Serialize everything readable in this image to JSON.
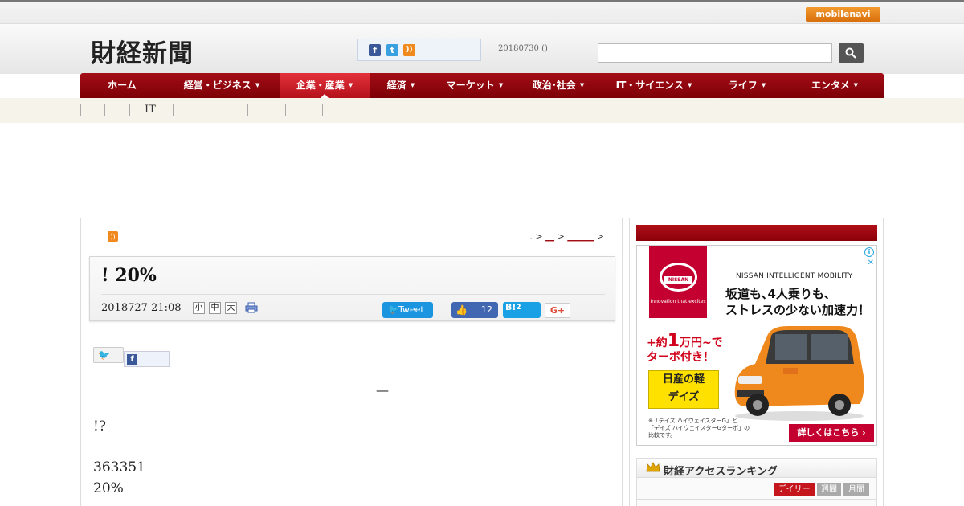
{
  "topbar": {
    "mobilenavi": "mobilenavi"
  },
  "header": {
    "logo": "財経新聞",
    "date": "20180730 ()",
    "search": {
      "value": "",
      "placeholder": ""
    },
    "social": {
      "facebook": "f",
      "twitter": "t",
      "rss": "))"
    }
  },
  "nav": {
    "items": [
      {
        "label": "ホーム",
        "caret": ""
      },
      {
        "label": "経営・ビジネス",
        "caret": "▼"
      },
      {
        "label": "企業・産業",
        "caret": "▼"
      },
      {
        "label": "経済",
        "caret": "▼"
      },
      {
        "label": "マーケット",
        "caret": "▼"
      },
      {
        "label": "政治･社会",
        "caret": "▼"
      },
      {
        "label": "IT・サイエンス",
        "caret": "▼"
      },
      {
        "label": "ライフ",
        "caret": "▼"
      },
      {
        "label": "エンタメ",
        "caret": "▼"
      }
    ],
    "active_index": 2
  },
  "subnav": {
    "items": [
      "",
      "",
      "IT",
      "",
      "",
      "",
      ""
    ]
  },
  "article": {
    "rss": "))",
    "breadcrumb": {
      "prefix": ". >",
      "link1": "__",
      "sep": ">",
      "link2": "______",
      "suffix": ">"
    },
    "title": "! 20%",
    "date": "2018727 21:08",
    "font_sizes": [
      "小",
      "中",
      "大"
    ],
    "tweet_label": "Tweet",
    "tweet_icon": "🐦",
    "like_icon": "👍",
    "like_count": "12",
    "hatena_label": "B!",
    "hatena_count": "2",
    "gplus_label": "G+",
    "share_tw_icon": "🐦",
    "share_fb_icon": "f",
    "dash": "—",
    "paragraphs": [
      "!?",
      "363351",
      "20%"
    ]
  },
  "sidebar": {
    "ad": {
      "brand_logo": "NISSAN",
      "slogan": "Innovation that excites",
      "brandline": "NISSAN INTELLIGENT MOBILITY",
      "headline1": "坂道も､4人乗りも､",
      "headline2": "ストレスの少ない加速力！",
      "price1_pre": "+約",
      "price1_big": "1",
      "price1_post": "万円~で",
      "price2": "ターボ付き！",
      "yellow1": "日産の軽",
      "yellow2": "デイズ",
      "note1": "※「デイズ ハイウェイスターG」と",
      "note2": "「デイズ ハイウェイスターGターボ」の",
      "note3": "比較です。",
      "cta": "詳しくはこちら ›",
      "info": "i",
      "close": "✕"
    },
    "ranking": {
      "title": "財経アクセスランキング",
      "tabs": [
        "デイリー",
        "週間",
        "月間"
      ]
    }
  },
  "colors": {
    "brand_red": "#a30d16",
    "accent_red": "#e3303a",
    "nissan_red": "#c3002f"
  }
}
